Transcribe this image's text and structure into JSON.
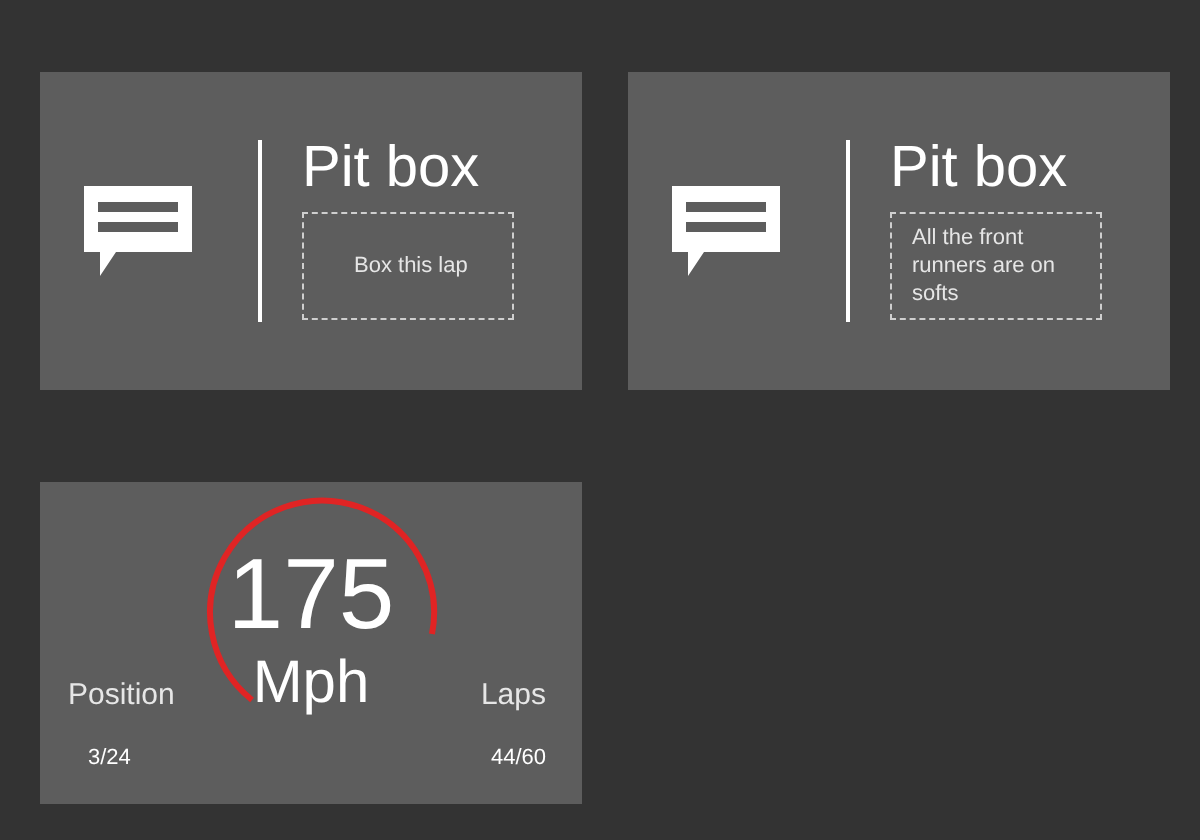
{
  "messages": [
    {
      "title": "Pit box",
      "body": "Box this lap"
    },
    {
      "title": "Pit box",
      "body": "All the front runners are on softs"
    }
  ],
  "gauge": {
    "speed": "175",
    "unit": "Mph",
    "stats": [
      {
        "label": "Position",
        "value": "3/24"
      },
      {
        "label": "Laps",
        "value": "44/60"
      }
    ]
  }
}
